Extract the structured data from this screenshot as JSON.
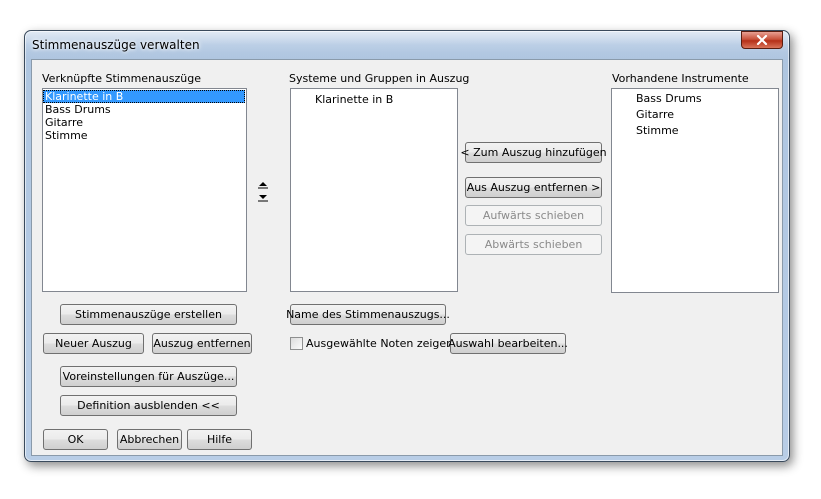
{
  "window": {
    "title": "Stimmenauszüge verwalten"
  },
  "left": {
    "label": "Verknüpfte Stimmenauszüge",
    "items": [
      "Klarinette in B",
      "Bass Drums",
      "Gitarre",
      "Stimme"
    ],
    "selected_index": 0,
    "create_button": "Stimmenauszüge erstellen",
    "new_button": "Neuer Auszug",
    "remove_button": "Auszug entfernen",
    "defaults_button": "Voreinstellungen für Auszüge...",
    "hide_button": "Definition ausblenden <<",
    "ok_button": "OK",
    "cancel_button": "Abbrechen",
    "help_button": "Hilfe"
  },
  "middle": {
    "label": "Systeme und Gruppen in Auszug",
    "items": [
      "Klarinette in B"
    ],
    "name_button": "Name des Stimmenauszugs...",
    "show_notes_label": "Ausgewählte Noten zeigen",
    "edit_selection_button": "Auswahl bearbeiten..."
  },
  "actions": {
    "add_button": "< Zum Auszug hinzufügen",
    "remove_button": "Aus Auszug entfernen >",
    "up_button": "Aufwärts schieben",
    "down_button": "Abwärts schieben"
  },
  "right": {
    "label": "Vorhandene Instrumente",
    "items": [
      "Bass Drums",
      "Gitarre",
      "Stimme"
    ]
  }
}
